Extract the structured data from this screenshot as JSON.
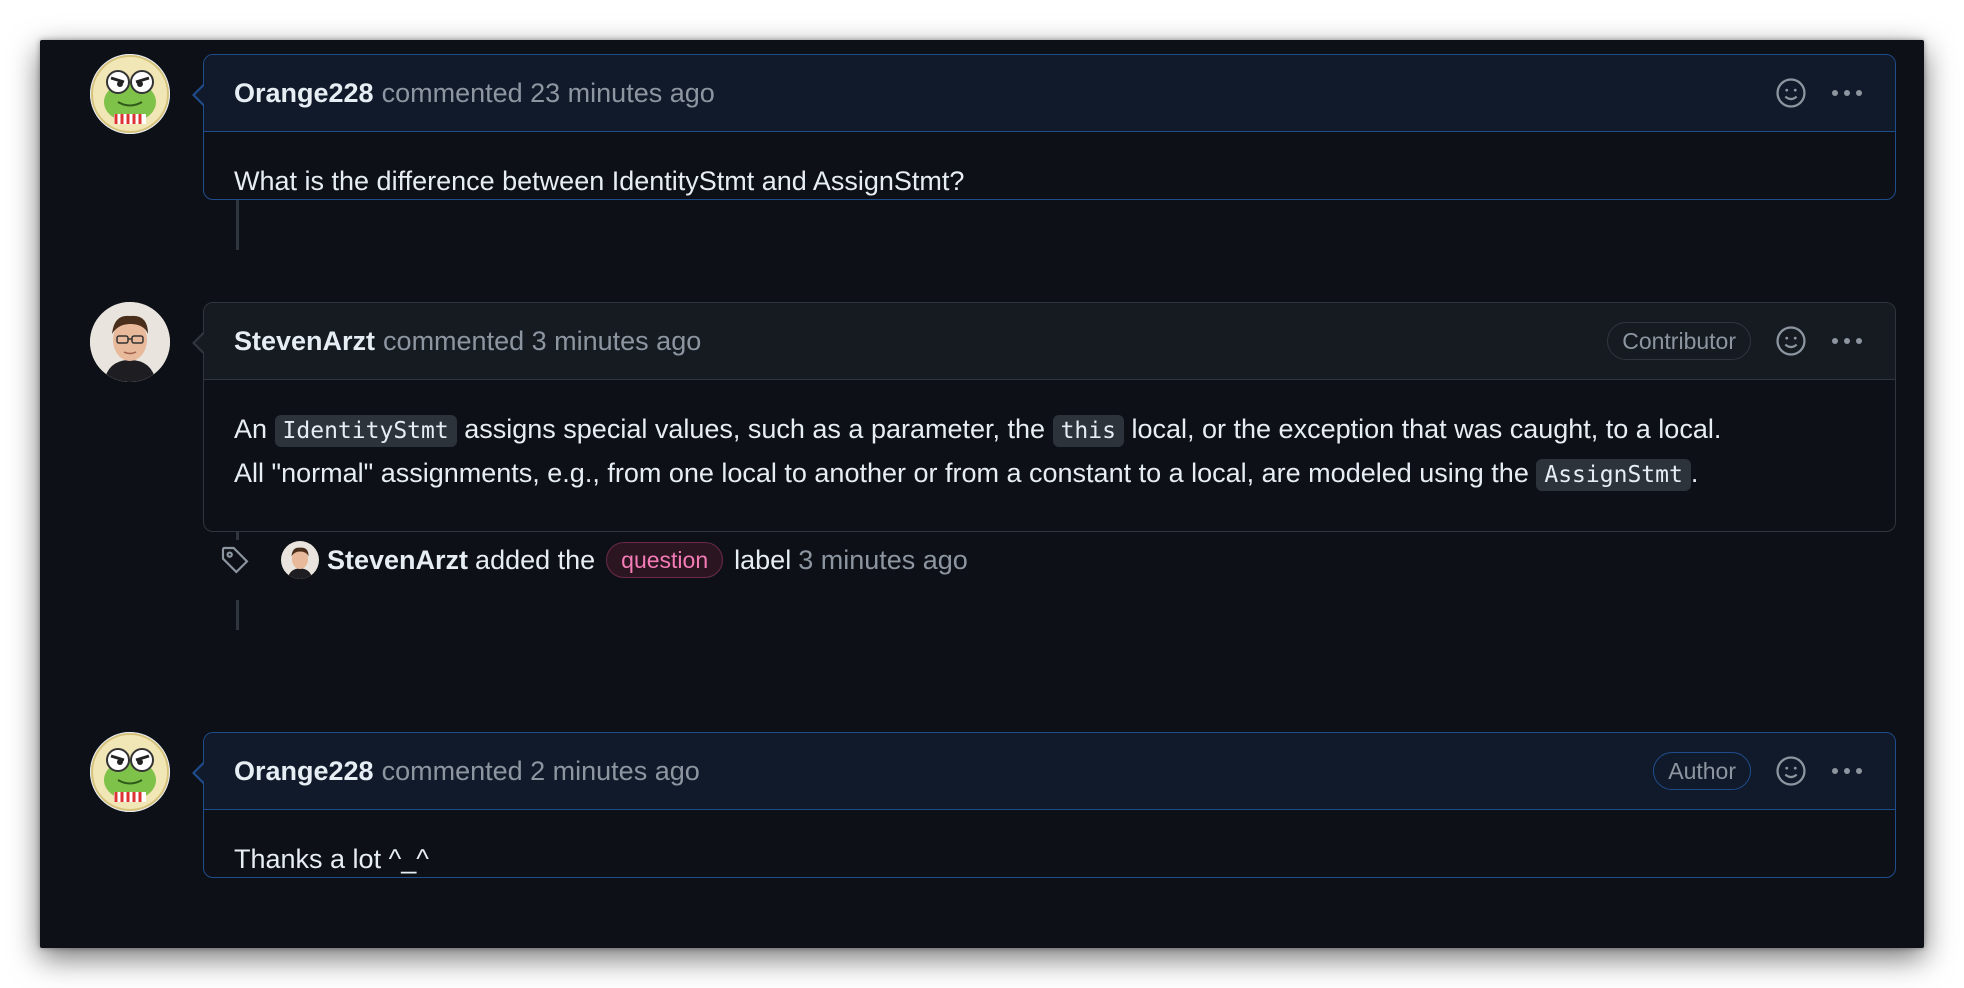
{
  "comments": [
    {
      "author": "Orange228",
      "meta": "commented 23 minutes ago",
      "badge": "",
      "body": "What is the difference between IdentityStmt and AssignStmt?"
    },
    {
      "author": "StevenArzt",
      "meta": "commented 3 minutes ago",
      "badge": "Contributor",
      "body_parts": {
        "p1": "An",
        "code1": "IdentityStmt",
        "p2": "assigns special values, such as a parameter, the",
        "code2": "this",
        "p3": "local, or the exception that was caught, to a local.",
        "p4": "All \"normal\" assignments, e.g., from one local to another or from a constant to a local, are modeled using the",
        "code3": "AssignStmt",
        "p5": "."
      }
    },
    {
      "author": "Orange228",
      "meta": "commented 2 minutes ago",
      "badge": "Author",
      "body": "Thanks a lot ^_^"
    }
  ],
  "event": {
    "actor": "StevenArzt",
    "text_before": "added the",
    "label": "question",
    "text_after": "label",
    "time": "3 minutes ago"
  },
  "icons": {
    "reaction": "smiley-icon",
    "menu": "kebab-horizontal-icon",
    "label": "tag-icon"
  },
  "colors": {
    "background": "#0d1117",
    "owner_border": "#1f4d8c",
    "label_text": "#f47bb5"
  }
}
